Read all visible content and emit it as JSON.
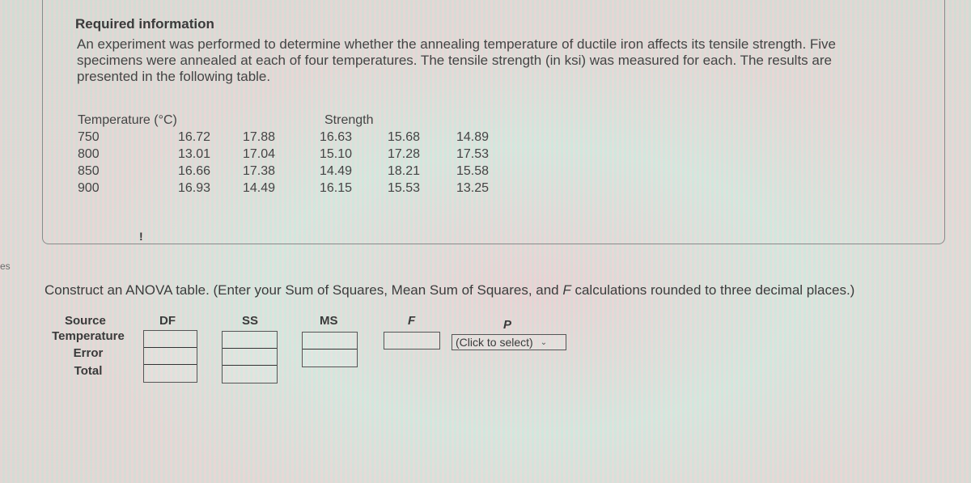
{
  "side_fragment": "es",
  "required_info": {
    "title": "Required information",
    "paragraph": "An experiment was performed to determine whether the annealing temperature of ductile iron affects its tensile strength. Five specimens were annealed at each of four temperatures. The tensile strength (in ksi) was measured for each. The results are presented in the following table."
  },
  "data_table": {
    "col_header_temperature": "Temperature (°C)",
    "col_header_strength": "Strength",
    "rows": [
      {
        "temp": "750",
        "values": [
          "16.72",
          "17.88",
          "16.63",
          "15.68",
          "14.89"
        ]
      },
      {
        "temp": "800",
        "values": [
          "13.01",
          "17.04",
          "15.10",
          "17.28",
          "17.53"
        ]
      },
      {
        "temp": "850",
        "values": [
          "16.66",
          "17.38",
          "14.49",
          "18.21",
          "15.58"
        ]
      },
      {
        "temp": "900",
        "values": [
          "16.93",
          "14.49",
          "16.15",
          "15.53",
          "13.25"
        ]
      }
    ]
  },
  "alert_mark": "!",
  "instruction": {
    "before_f": "Construct an ANOVA table. (Enter your Sum of Squares, Mean Sum of Squares, and ",
    "f_symbol": "F",
    "after_f": " calculations rounded to three decimal places.)"
  },
  "anova": {
    "headers": {
      "source": "Source",
      "df": "DF",
      "ss": "SS",
      "ms": "MS",
      "f": "F",
      "p": "P"
    },
    "sources": [
      "Temperature",
      "Error",
      "Total"
    ],
    "df_values": [
      "",
      "",
      ""
    ],
    "ss_values": [
      "",
      "",
      ""
    ],
    "ms_values": [
      "",
      ""
    ],
    "f_value": "",
    "p_select": {
      "selected": "(Click to select)"
    }
  }
}
